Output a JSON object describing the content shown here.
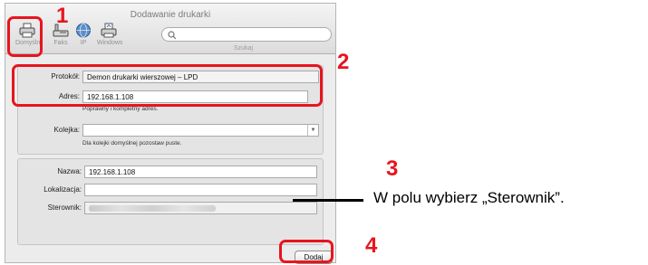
{
  "window": {
    "title": "Dodawanie drukarki"
  },
  "toolbar": {
    "items": [
      {
        "label": "Domyśln",
        "icon": "printer-icon"
      },
      {
        "label": "Faks",
        "icon": "fax-icon"
      },
      {
        "label": "IP",
        "icon": "globe-icon"
      },
      {
        "label": "Windows",
        "icon": "windows-printer-icon"
      }
    ],
    "search": {
      "placeholder": "",
      "caption": "Szukaj"
    }
  },
  "form": {
    "protocol": {
      "label": "Protokół:",
      "value": "Demon drukarki wierszowej – LPD"
    },
    "address": {
      "label": "Adres:",
      "value": "192.168.1.108",
      "hint": "Poprawny i kompletny adres."
    },
    "queue": {
      "label": "Kolejka:",
      "value": "",
      "hint": "Dla kolejki domyślnej pozostaw puste."
    },
    "name": {
      "label": "Nazwa:",
      "value": "192.168.1.108"
    },
    "location": {
      "label": "Lokalizacja:",
      "value": ""
    },
    "driver": {
      "label": "Sterownik:"
    }
  },
  "add_button": {
    "label": "Dodaj"
  },
  "annotations": {
    "steps": [
      "1",
      "2",
      "3",
      "4"
    ],
    "instruction": "W polu wybierz „Sterownik”.",
    "color": "#e8141e"
  }
}
